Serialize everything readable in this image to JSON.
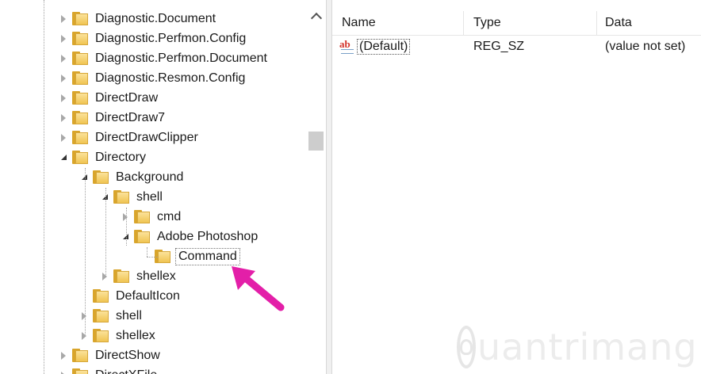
{
  "tree": {
    "items": [
      {
        "label": "Diagnostic.Document",
        "depth": 0,
        "state": "collapsed"
      },
      {
        "label": "Diagnostic.Perfmon.Config",
        "depth": 0,
        "state": "collapsed"
      },
      {
        "label": "Diagnostic.Perfmon.Document",
        "depth": 0,
        "state": "collapsed"
      },
      {
        "label": "Diagnostic.Resmon.Config",
        "depth": 0,
        "state": "collapsed"
      },
      {
        "label": "DirectDraw",
        "depth": 0,
        "state": "collapsed"
      },
      {
        "label": "DirectDraw7",
        "depth": 0,
        "state": "collapsed"
      },
      {
        "label": "DirectDrawClipper",
        "depth": 0,
        "state": "collapsed"
      },
      {
        "label": "Directory",
        "depth": 0,
        "state": "expanded"
      },
      {
        "label": "Background",
        "depth": 1,
        "state": "expanded"
      },
      {
        "label": "shell",
        "depth": 2,
        "state": "expanded"
      },
      {
        "label": "cmd",
        "depth": 3,
        "state": "collapsed"
      },
      {
        "label": "Adobe Photoshop",
        "depth": 3,
        "state": "expanded"
      },
      {
        "label": "Command",
        "depth": 4,
        "state": "leaf",
        "selected": true
      },
      {
        "label": "shellex",
        "depth": 2,
        "state": "collapsed"
      },
      {
        "label": "DefaultIcon",
        "depth": 1,
        "state": "leaf"
      },
      {
        "label": "shell",
        "depth": 1,
        "state": "collapsed"
      },
      {
        "label": "shellex",
        "depth": 1,
        "state": "collapsed"
      },
      {
        "label": "DirectShow",
        "depth": 0,
        "state": "collapsed"
      },
      {
        "label": "DirectXFile",
        "depth": 0,
        "state": "collapsed"
      }
    ]
  },
  "list": {
    "columns": {
      "name": "Name",
      "type": "Type",
      "data": "Data"
    },
    "rows": [
      {
        "name": "(Default)",
        "type": "REG_SZ",
        "data": "(value not set)",
        "icon": "string-value-icon"
      }
    ]
  },
  "watermark": {
    "text": "uantrimang"
  },
  "colors": {
    "arrow": "#e31fa8",
    "folder": "#f0c452",
    "selection_border": "#777777"
  }
}
